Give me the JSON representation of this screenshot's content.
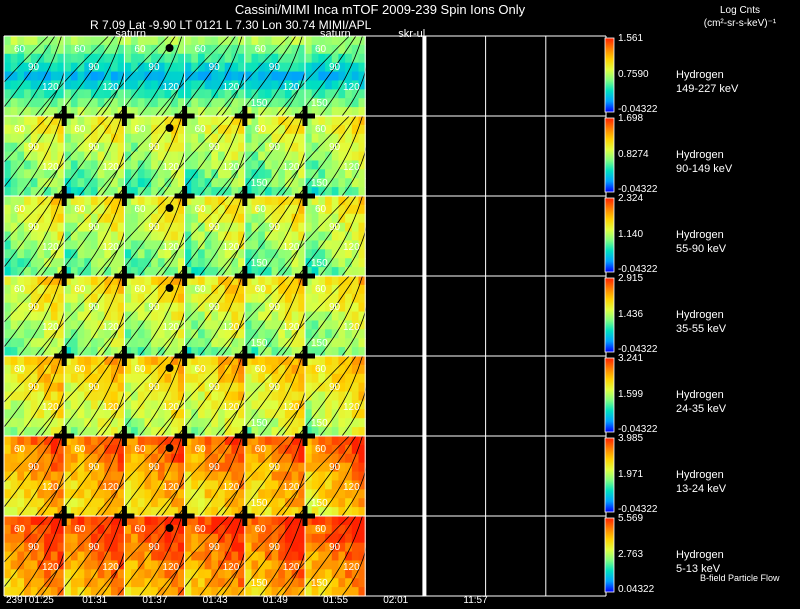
{
  "header": {
    "title": "Cassini/MIMI Inca mTOF  2009-239   Spin    Ions Only",
    "line2": "R      7.09 Lat -9.90 LT 0121 L      7.30 Lon       30.74  MIMI/APL",
    "colorbar_units_1": "Log Cnts",
    "colorbar_units_2": "(cm²-sr-s-keV)⁻¹"
  },
  "frame_labels": [
    "saturn",
    "skr-ul",
    "saturn"
  ],
  "footer": "B-field Particle Flow",
  "chart_data": {
    "type": "heatmap",
    "description_type": "energetic neutral atom image grid",
    "x_tick_labels": [
      "239T01:25",
      "01:31",
      "01:37",
      "01:43",
      "01:49",
      "01:55",
      "02:01",
      "11:57"
    ],
    "rows": [
      {
        "species": "Hydrogen",
        "energy": "149-227 keV",
        "cbar_max": "1.561",
        "cbar_mid": "0.7590",
        "cbar_min": "-0.04322",
        "level": 0.35
      },
      {
        "species": "Hydrogen",
        "energy": "90-149 keV",
        "cbar_max": "1.698",
        "cbar_mid": "0.8274",
        "cbar_min": "-0.04322",
        "level": 0.5
      },
      {
        "species": "Hydrogen",
        "energy": "55-90 keV",
        "cbar_max": "2.324",
        "cbar_mid": "1.140",
        "cbar_min": "-0.04322",
        "level": 0.52
      },
      {
        "species": "Hydrogen",
        "energy": "35-55 keV",
        "cbar_max": "2.915",
        "cbar_mid": "1.436",
        "cbar_min": "-0.04322",
        "level": 0.55
      },
      {
        "species": "Hydrogen",
        "energy": "24-35 keV",
        "cbar_max": "3.241",
        "cbar_mid": "1.599",
        "cbar_min": "-0.04322",
        "level": 0.62
      },
      {
        "species": "Hydrogen",
        "energy": "13-24 keV",
        "cbar_max": "3.985",
        "cbar_mid": "1.971",
        "cbar_min": "-0.04322",
        "level": 0.78
      },
      {
        "species": "Hydrogen",
        "energy": "5-13 keV",
        "cbar_max": "5.569",
        "cbar_mid": "2.763",
        "cbar_min": "0.04322",
        "level": 0.86
      }
    ],
    "filled_columns": 6,
    "total_columns": 10,
    "contour_labels": [
      "30",
      "60",
      "90",
      "120",
      "150"
    ],
    "colormap": [
      "#0000ff",
      "#00a0ff",
      "#00e0c0",
      "#80ff80",
      "#e0ff40",
      "#ffd000",
      "#ff8000",
      "#ff2000"
    ]
  }
}
